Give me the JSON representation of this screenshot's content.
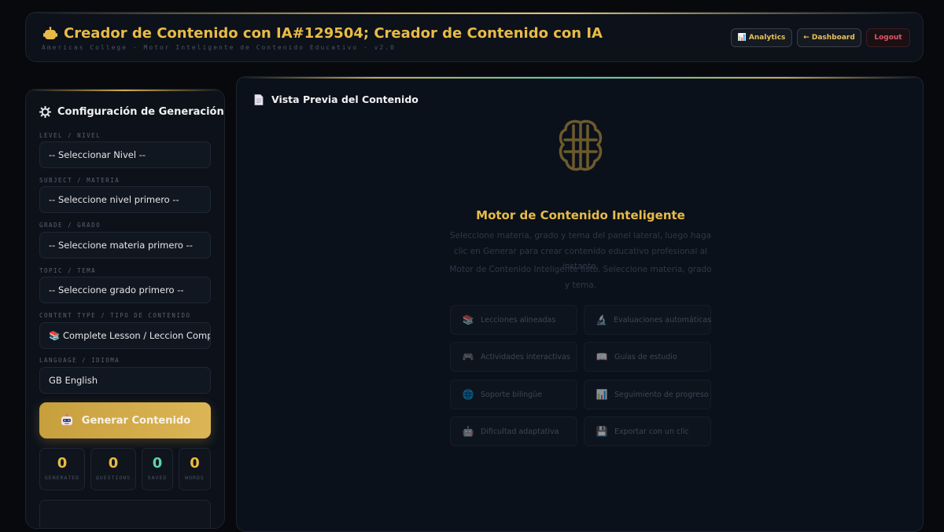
{
  "header": {
    "title": "Creador de Contenido con IA#129504; Creador de Contenido con IA",
    "subtitle": "Americas College · Motor Inteligente de Contenido Educativo · v2.0",
    "buttons": {
      "analytics": "📊 Analytics",
      "dashboard": "← Dashboard",
      "logout": "Logout"
    }
  },
  "sidebar": {
    "title": "Configuración de Generación",
    "fields": [
      {
        "label": "LEVEL / NIVEL",
        "value": "-- Seleccionar Nivel --"
      },
      {
        "label": "SUBJECT / MATERIA",
        "value": "-- Seleccione nivel primero --"
      },
      {
        "label": "GRADE / GRADO",
        "value": "-- Seleccione materia primero --"
      },
      {
        "label": "TOPIC / TEMA",
        "value": "-- Seleccione grado primero --"
      },
      {
        "label": "CONTENT TYPE / TIPO DE CONTENIDO",
        "value": "📚 Complete Lesson / Leccion Completa"
      },
      {
        "label": "LANGUAGE / IDIOMA",
        "value": "GB English"
      }
    ],
    "generate_label": "Generar Contenido",
    "stats": [
      {
        "value": "0",
        "label": "GENERATED",
        "color": "#e8bb47"
      },
      {
        "value": "0",
        "label": "QUESTIONS",
        "color": "#e8bb47"
      },
      {
        "value": "0",
        "label": "SAVED",
        "color": "#5dd3a8"
      },
      {
        "value": "0",
        "label": "WORDS",
        "color": "#e8bb47"
      }
    ]
  },
  "main": {
    "title": "Vista Previa del Contenido",
    "engine_title": "Motor de Contenido Inteligente",
    "engine_desc": "Seleccione materia, grado y tema del panel lateral, luego haga clic en Generar para crear contenido educativo profesional al instante.",
    "engine_status": "Motor de Contenido Inteligente listo. Seleccione materia, grado y tema.",
    "features": [
      {
        "icon": "books-icon",
        "glyph": "📚",
        "label": "Lecciones alineadas"
      },
      {
        "icon": "microscope-icon",
        "glyph": "🔬",
        "label": "Evaluaciones automáticas"
      },
      {
        "icon": "gamepad-icon",
        "glyph": "🎮",
        "label": "Actividades interactivas"
      },
      {
        "icon": "book-icon",
        "glyph": "📖",
        "label": "Guías de estudio"
      },
      {
        "icon": "globe-icon",
        "glyph": "🌐",
        "label": "Soporte bilingüe"
      },
      {
        "icon": "chart-icon",
        "glyph": "📊",
        "label": "Seguimiento de progreso"
      },
      {
        "icon": "robot-icon",
        "glyph": "🤖",
        "label": "Dificultad adaptativa"
      },
      {
        "icon": "save-icon",
        "glyph": "💾",
        "label": "Exportar con un clic"
      }
    ]
  },
  "colors": {
    "accent": "#e8bb47",
    "background": "#07090d",
    "panel": "#0c111a",
    "success": "#5dd3a8",
    "danger": "#e0556b"
  }
}
